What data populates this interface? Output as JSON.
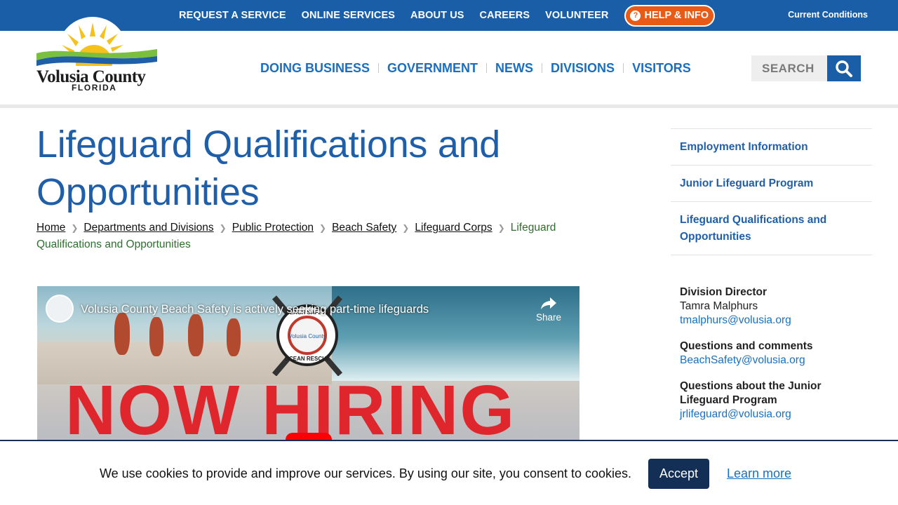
{
  "topbar": {
    "links": [
      "REQUEST A SERVICE",
      "ONLINE SERVICES",
      "ABOUT US",
      "CAREERS",
      "VOLUNTEER"
    ],
    "help": "HELP & INFO",
    "current_conditions": "Current Conditions",
    "color": "#1a5ea8",
    "help_color": "#ea5a17"
  },
  "logo": {
    "name": "Volusia County",
    "sub": "FLORIDA"
  },
  "mainnav": [
    "DOING BUSINESS",
    "GOVERNMENT",
    "NEWS",
    "DIVISIONS",
    "VISITORS"
  ],
  "search": {
    "placeholder": "SEARCH",
    "icon": "magnifier-icon"
  },
  "page": {
    "title": "Lifeguard Qualifications and Opportunities",
    "breadcrumb": [
      "Home",
      "Departments and Divisions",
      "Public Protection",
      "Beach Safety",
      "Lifeguard Corps"
    ],
    "breadcrumb_current": "Lifeguard Qualifications and Opportunities"
  },
  "video": {
    "title": "Volusia County Beach Safety is actively seeking part-time lifeguards",
    "share": "Share",
    "overlay_text": "NOW HIRING",
    "badge_text": [
      "BEACH SAFETY",
      "OCEAN RESCUE",
      "Volusia County"
    ]
  },
  "sidebar": {
    "links": [
      "Employment Information",
      "Junior Lifeguard Program",
      "Lifeguard Qualifications and Opportunities"
    ],
    "contacts": [
      {
        "label": "Division Director",
        "name": "Tamra Malphurs",
        "email": "tmalphurs@volusia.org"
      },
      {
        "label": "Questions and comments",
        "email": "BeachSafety@volusia.org"
      },
      {
        "label": "Questions about the Junior Lifeguard Program",
        "email": "jrlifeguard@volusia.org"
      }
    ]
  },
  "cookie": {
    "message": "We use cookies to provide and improve our services. By using our site, you consent to cookies.",
    "accept": "Accept",
    "learn": "Learn more"
  }
}
